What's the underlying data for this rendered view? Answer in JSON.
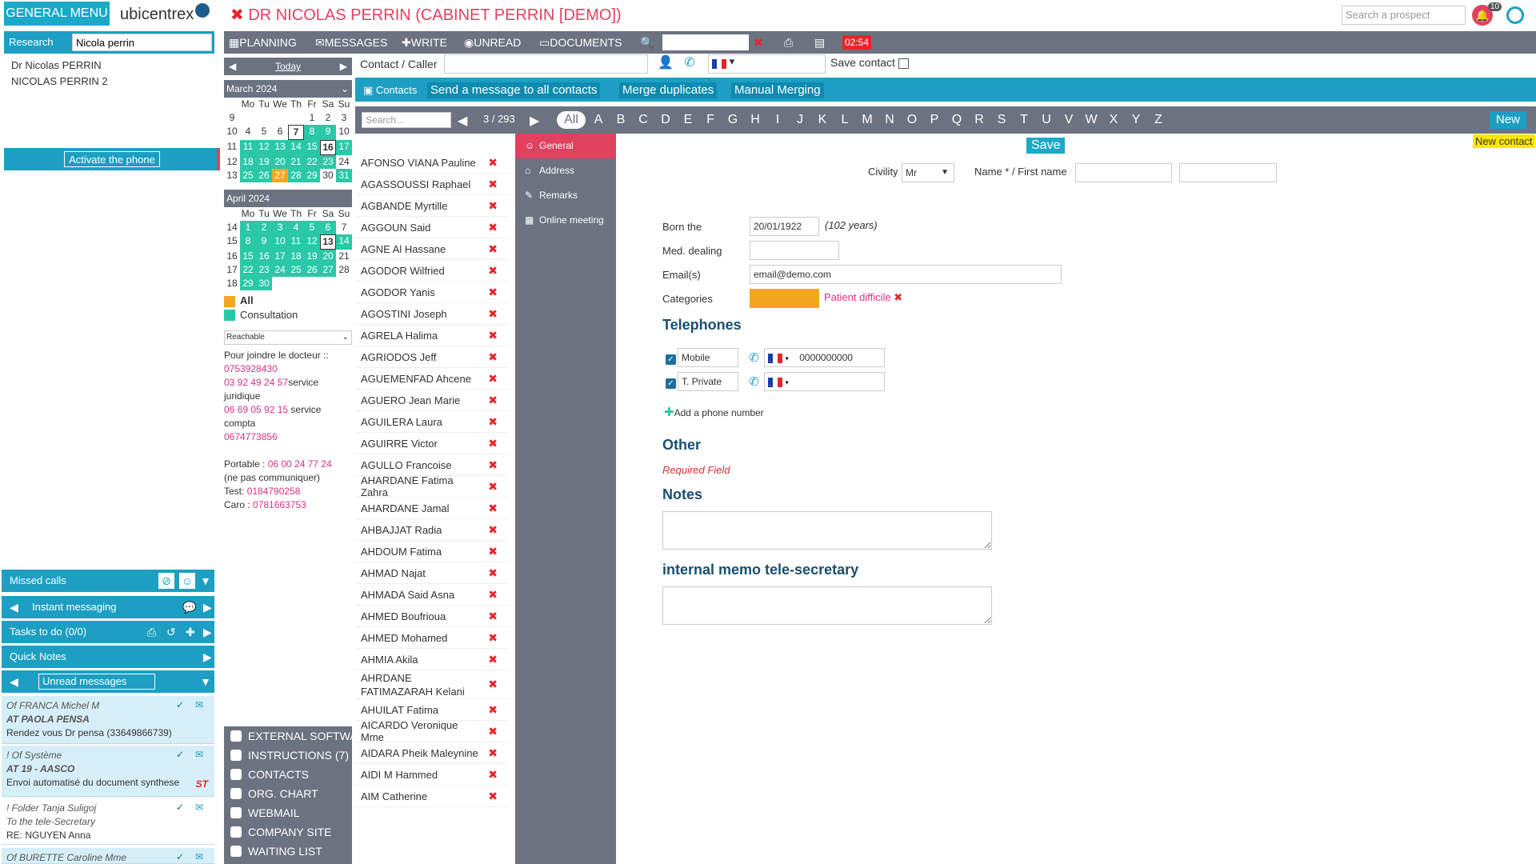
{
  "app": {
    "menu_label": "GENERAL MENU",
    "logo_text": "ubicentrex",
    "title": "DR NICOLAS PERRIN (CABINET PERRIN [DEMO])",
    "search_prospect_placeholder": "Search a prospect",
    "notif_count": "10"
  },
  "research": {
    "label": "Research",
    "value": "Nicola perrin",
    "results": [
      "Dr Nicolas PERRIN",
      "NICOLAS PERRIN 2"
    ],
    "activate_phone": "Activate the phone"
  },
  "toolbar": {
    "planning": "PLANNING",
    "messages": "MESSAGES",
    "write": "WRITE",
    "unread": "UNREAD",
    "documents": "DOCUMENTS",
    "timer": "02:54"
  },
  "today_label": "Today",
  "contact_caller": {
    "label": "Contact / Caller",
    "save_contact": "Save contact"
  },
  "calendar": {
    "march": {
      "title": "March 2024",
      "days": [
        "Mo",
        "Tu",
        "We",
        "Th",
        "Fr",
        "Sa",
        "Su"
      ],
      "weeks": [
        {
          "wk": "9",
          "d": [
            "",
            "",
            "",
            "",
            "1",
            "2",
            "3"
          ]
        },
        {
          "wk": "10",
          "d": [
            "4",
            "5",
            "6",
            "7",
            "8",
            "9",
            "10"
          ]
        },
        {
          "wk": "11",
          "d": [
            "11",
            "12",
            "13",
            "14",
            "15",
            "16",
            "17"
          ]
        },
        {
          "wk": "12",
          "d": [
            "18",
            "19",
            "20",
            "21",
            "22",
            "23",
            "24"
          ]
        },
        {
          "wk": "13",
          "d": [
            "25",
            "26",
            "27",
            "28",
            "29",
            "30",
            "31"
          ]
        }
      ]
    },
    "april": {
      "title": "April 2024",
      "weeks": [
        {
          "wk": "14",
          "d": [
            "1",
            "2",
            "3",
            "4",
            "5",
            "6",
            "7"
          ]
        },
        {
          "wk": "15",
          "d": [
            "8",
            "9",
            "10",
            "11",
            "12",
            "13",
            "14"
          ]
        },
        {
          "wk": "16",
          "d": [
            "15",
            "16",
            "17",
            "18",
            "19",
            "20",
            "21"
          ]
        },
        {
          "wk": "17",
          "d": [
            "22",
            "23",
            "24",
            "25",
            "26",
            "27",
            "28"
          ]
        },
        {
          "wk": "18",
          "d": [
            "29",
            "30",
            "",
            "",
            "",
            "",
            ""
          ]
        }
      ]
    },
    "legend_all": "All",
    "legend_consultation": "Consultation",
    "reachable": "Reachable",
    "colors": {
      "green": "#2bc8a8",
      "orange": "#f4a623"
    }
  },
  "doctor_note": {
    "intro": "Pour joindre le docteur ::",
    "phone1": "0753928430",
    "phone2": "03 92 49 24 57",
    "phone2_suffix": "service juridique",
    "phone3": "06 69 05 92 15",
    "phone3_suffix": "service compta",
    "phone4": "0674773856",
    "portable_label": "Portable : ",
    "portable": "06 00 24 77 24",
    "portable_note": "(ne pas communiquer)",
    "test_label": "Test: ",
    "test": "0184790258",
    "caro_label": "Caro : ",
    "caro": "0781663753"
  },
  "left_panels": {
    "missed_calls": "Missed calls",
    "instant_messaging": "Instant messaging",
    "tasks": "Tasks to do (0/0)",
    "quick_notes": "Quick Notes",
    "unread_messages": "Unread messages"
  },
  "messages": [
    {
      "line1": "Of FRANCA Michel M",
      "line2": "AT PAOLA PENSA",
      "line3": "Rendez vous Dr pensa (33649866739)"
    },
    {
      "line1": "! Of Système",
      "line2": "AT 19 - AASCO",
      "line3": "Envoi automatisé du document synthese",
      "tag": "ST"
    },
    {
      "line1": "! Folder Tanja Suligoj",
      "line2": "To the tele-Secretary",
      "line3": "RE: NGUYEN Anna"
    },
    {
      "line1": "Of BURETTE Caroline Mme",
      "line2": "",
      "line3": ""
    }
  ],
  "bottom_menu": [
    "EXTERNAL SOFTWARE",
    "INSTRUCTIONS (7)",
    "CONTACTS",
    "ORG. CHART",
    "WEBMAIL",
    "COMPANY SITE",
    "WAITING LIST"
  ],
  "contacts_bar": {
    "contacts": "Contacts",
    "send_all": "Send a message to all contacts",
    "merge_duplicates": "Merge duplicates",
    "manual_merging": "Manual Merging"
  },
  "alpha": {
    "search_placeholder": "Search...",
    "page": "3 / 293",
    "letters": [
      "All",
      "A",
      "B",
      "C",
      "D",
      "E",
      "F",
      "G",
      "H",
      "I",
      "J",
      "K",
      "L",
      "M",
      "N",
      "O",
      "P",
      "Q",
      "R",
      "S",
      "T",
      "U",
      "V",
      "W",
      "X",
      "Y",
      "Z"
    ],
    "new": "New"
  },
  "contacts": [
    "AFONSO VIANA Pauline",
    "AGASSOUSSI Raphael",
    "AGBANDE Myrtille",
    "AGGOUN Said",
    "AGNE Al Hassane",
    "AGODOR Wilfried",
    "AGODOR Yanis",
    "AGOSTINI Joseph",
    "AGRELA Halima",
    "AGRIODOS Jeff",
    "AGUEMENFAD Ahcene",
    "AGUERO Jean Marie",
    "AGUILERA Laura",
    "AGUIRRE Victor",
    "AGULLO Francoise",
    "AHARDANE Fatima Zahra",
    "AHARDANE Jamal",
    "AHBAJJAT Radia",
    "AHDOUM Fatima",
    "AHMAD Najat",
    "AHMADA Said Asna",
    "AHMED Boufrioua",
    "AHMED Mohamed",
    "AHMIA Akila",
    "AHRDANE FATIMAZARAH Kelani",
    "AHUILAT Fatima",
    "AICARDO Veronique Mme",
    "AIDARA Pheik Maleynine",
    "AIDI M Hammed",
    "AIM Catherine"
  ],
  "side_tabs": [
    "General",
    "Address",
    "Remarks",
    "Online meeting"
  ],
  "form": {
    "save": "Save",
    "new_contact": "New contact",
    "civility_label": "Civility",
    "civility_value": "Mr",
    "name_label": "Name * / First name",
    "born_label": "Born the",
    "born_value": "20/01/1922",
    "age": "(102 years)",
    "med_label": "Med. dealing",
    "email_label": "Email(s)",
    "email_value": "email@demo.com",
    "categories_label": "Categories",
    "category_link": "Patient difficile",
    "category_color": "#f4a623",
    "telephones_title": "Telephones",
    "phone1_type": "Mobile",
    "phone1_value": "0000000000",
    "phone2_type": "T. Private",
    "add_phone": "Add a phone number",
    "other_title": "Other",
    "required_field": "Required Field",
    "notes_title": "Notes",
    "memo_title": "internal memo tele-secretary"
  }
}
